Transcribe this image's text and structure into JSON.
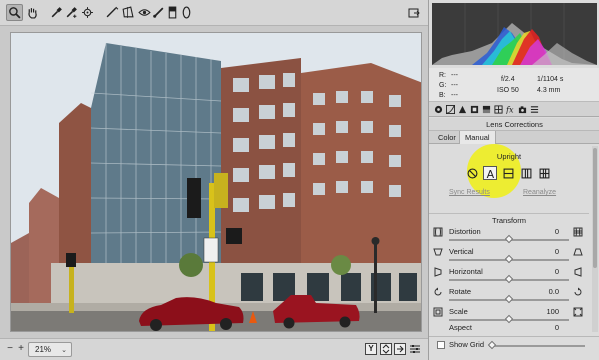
{
  "toolbar": {
    "tools": [
      "zoom-tool",
      "hand-tool",
      "white-balance-tool",
      "color-sampler-tool",
      "targeted-adjustment-tool",
      "straighten-tool",
      "red-eye-tool",
      "adjustment-brush-tool",
      "graduated-filter-tool",
      "radial-filter-tool"
    ],
    "active_tool": "zoom-tool"
  },
  "canvas": {
    "image": "photo-building-street-corner"
  },
  "bottom_bar": {
    "zoom_minus": "−",
    "zoom_plus": "+",
    "zoom_value": "21%",
    "view_buttons": [
      "Y"
    ]
  },
  "readout": {
    "r_label": "R:",
    "g_label": "G:",
    "b_label": "B:",
    "r_value": "---",
    "g_value": "---",
    "b_value": "---",
    "aperture": "f/2.4",
    "shutter": "1/1104 s",
    "iso": "ISO 50",
    "focal": "4.3 mm"
  },
  "panel": {
    "section_title": "Lens Corrections",
    "tabs": [
      "Color",
      "Manual"
    ],
    "active_tab": "Manual",
    "upright_title": "Upright",
    "sync_results": "Sync Results",
    "reanalyze": "Reanalyze",
    "transform_title": "Transform",
    "sliders": [
      {
        "label": "Distortion",
        "value": "0",
        "pos": 0.5
      },
      {
        "label": "Vertical",
        "value": "0",
        "pos": 0.5
      },
      {
        "label": "Horizontal",
        "value": "0",
        "pos": 0.5
      },
      {
        "label": "Rotate",
        "value": "0.0",
        "pos": 0.5
      },
      {
        "label": "Scale",
        "value": "100",
        "pos": 0.5
      },
      {
        "label": "Aspect",
        "value": "0",
        "pos": 0.5
      }
    ],
    "show_grid": "Show Grid",
    "grid_slider_pos": 0.0
  },
  "colors": {
    "highlight": "#f0f014",
    "panel_bg": "#dcdcdc"
  }
}
